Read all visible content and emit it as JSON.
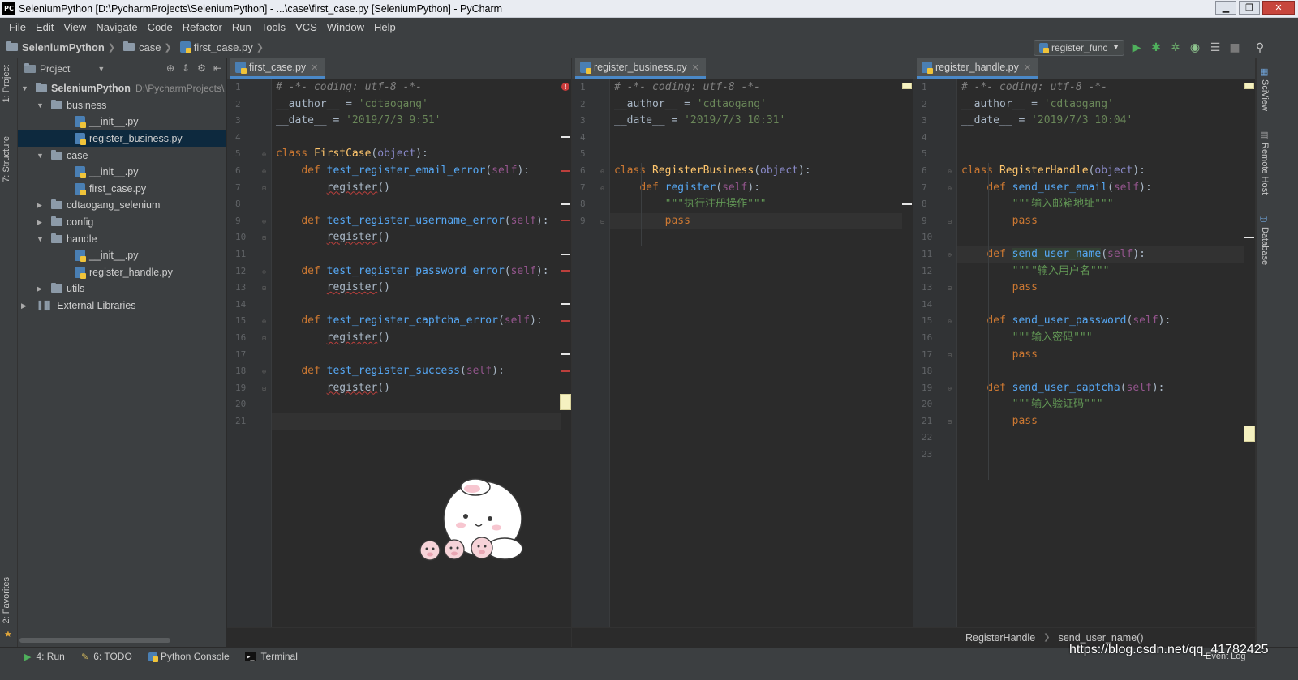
{
  "window": {
    "title": "SeleniumPython [D:\\PycharmProjects\\SeleniumPython] - ...\\case\\first_case.py [SeleniumPython] - PyCharm",
    "app_logo": "PC",
    "controls": [
      "minimize-icon",
      "maximize-icon",
      "close-icon"
    ]
  },
  "menu": [
    "File",
    "Edit",
    "View",
    "Navigate",
    "Code",
    "Refactor",
    "Run",
    "Tools",
    "VCS",
    "Window",
    "Help"
  ],
  "navbar": {
    "crumbs": [
      "SeleniumPython",
      "case",
      "first_case.py"
    ],
    "run_config": "register_func"
  },
  "left_strip": {
    "project": "1: Project",
    "structure": "7: Structure",
    "favorites": "2: Favorites"
  },
  "right_strip": {
    "sciview": "SciView",
    "remote": "Remote Host",
    "database": "Database"
  },
  "project": {
    "header": "Project",
    "tree": [
      {
        "label": "SeleniumPython",
        "path": "D:\\PycharmProjects\\",
        "depth": 0,
        "type": "folder",
        "open": true,
        "bold": true
      },
      {
        "label": "business",
        "depth": 1,
        "type": "folder",
        "open": true
      },
      {
        "label": "__init__.py",
        "depth": 2,
        "type": "py"
      },
      {
        "label": "register_business.py",
        "depth": 2,
        "type": "py",
        "selected": true
      },
      {
        "label": "case",
        "depth": 1,
        "type": "folder",
        "open": true
      },
      {
        "label": "__init__.py",
        "depth": 2,
        "type": "py"
      },
      {
        "label": "first_case.py",
        "depth": 2,
        "type": "py"
      },
      {
        "label": "cdtaogang_selenium",
        "depth": 1,
        "type": "folder",
        "open": false
      },
      {
        "label": "config",
        "depth": 1,
        "type": "folder",
        "open": false
      },
      {
        "label": "handle",
        "depth": 1,
        "type": "folder",
        "open": true
      },
      {
        "label": "__init__.py",
        "depth": 2,
        "type": "py"
      },
      {
        "label": "register_handle.py",
        "depth": 2,
        "type": "py"
      },
      {
        "label": "utils",
        "depth": 1,
        "type": "folder",
        "open": false
      },
      {
        "label": "External Libraries",
        "depth": 0,
        "type": "lib",
        "open": false
      }
    ]
  },
  "editors": [
    {
      "tab": "first_case.py",
      "lines": [
        "# -*- coding: utf-8 -*-",
        "__author__ = 'cdtaogang'",
        "__date__ = '2019/7/3 9:51'",
        "",
        "class FirstCase(object):",
        "    def test_register_email_error(self):",
        "        register()",
        "",
        "    def test_register_username_error(self):",
        "        register()",
        "",
        "    def test_register_password_error(self):",
        "        register()",
        "",
        "    def test_register_captcha_error(self):",
        "        register()",
        "",
        "    def test_register_success(self):",
        "        register()",
        "",
        ""
      ]
    },
    {
      "tab": "register_business.py",
      "lines": [
        "# -*- coding: utf-8 -*-",
        "__author__ = 'cdtaogang'",
        "__date__ = '2019/7/3 10:31'",
        "",
        "",
        "class RegisterBusiness(object):",
        "    def register(self):",
        "        \"\"\"执行注册操作\"\"\"",
        "        pass"
      ]
    },
    {
      "tab": "register_handle.py",
      "lines": [
        "# -*- coding: utf-8 -*-",
        "__author__ = 'cdtaogang'",
        "__date__ = '2019/7/3 10:04'",
        "",
        "",
        "class RegisterHandle(object):",
        "    def send_user_email(self):",
        "        \"\"\"输入邮箱地址\"\"\"",
        "        pass",
        "",
        "    def send_user_name(self):",
        "        \"\"\"\"输入用户名\"\"\"",
        "        pass",
        "",
        "    def send_user_password(self):",
        "        \"\"\"输入密码\"\"\"",
        "        pass",
        "",
        "    def send_user_captcha(self):",
        "        \"\"\"输入验证码\"\"\"",
        "        pass",
        "",
        ""
      ],
      "breadcrumb": [
        "RegisterHandle",
        "send_user_name()"
      ]
    }
  ],
  "bottom": {
    "tabs": [
      {
        "label": "4: Run",
        "icon": "run-icon"
      },
      {
        "label": "6: TODO",
        "icon": "todo-icon"
      },
      {
        "label": "Python Console",
        "icon": "python-console-icon"
      },
      {
        "label": "Terminal",
        "icon": "terminal-icon"
      }
    ],
    "event_log": "Event Log",
    "watermark": "https://blog.csdn.net/qq_41782425"
  },
  "colors": {
    "accent": "#4a88c7",
    "selection": "#0d293e",
    "background": "#2b2b2b",
    "panel": "#3c3f41"
  }
}
